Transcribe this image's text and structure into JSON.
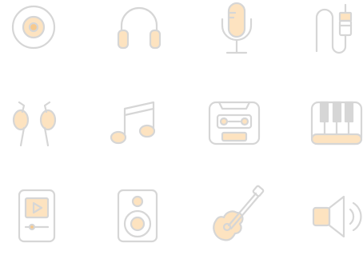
{
  "colors": {
    "outline": "#d6d6d6",
    "accent": "#fde3c0",
    "accent_dark": "#f7c98d",
    "background": "#ffffff"
  },
  "icons": [
    {
      "name": "vinyl-disc-icon"
    },
    {
      "name": "headphones-icon"
    },
    {
      "name": "microphone-icon"
    },
    {
      "name": "audio-jack-cable-icon"
    },
    {
      "name": "earbuds-icon"
    },
    {
      "name": "music-note-icon"
    },
    {
      "name": "cassette-tape-icon"
    },
    {
      "name": "piano-keys-icon"
    },
    {
      "name": "media-player-icon"
    },
    {
      "name": "speaker-icon"
    },
    {
      "name": "acoustic-guitar-icon"
    },
    {
      "name": "volume-icon"
    }
  ]
}
